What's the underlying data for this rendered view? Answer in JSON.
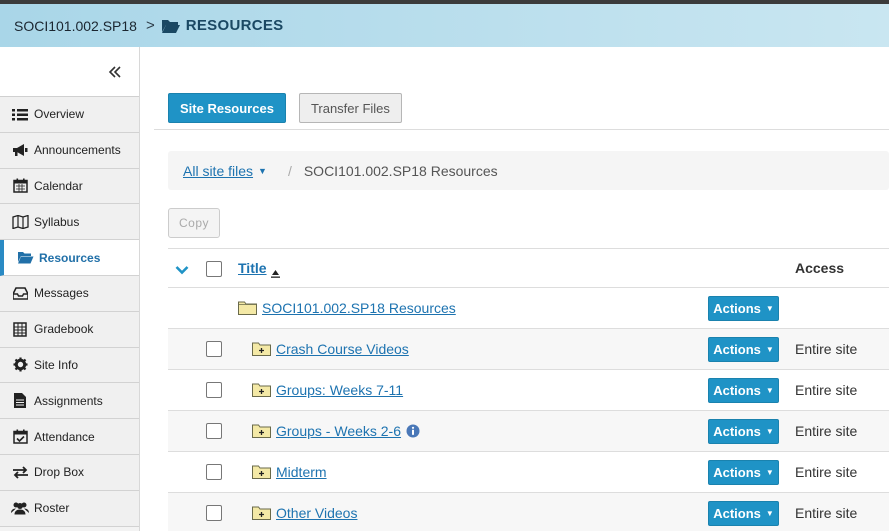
{
  "header": {
    "site_title": "SOCI101.002.SP18",
    "separator": ">",
    "tool_name": "RESOURCES"
  },
  "sidebar": {
    "items": [
      {
        "label": "Overview",
        "icon": "list-icon"
      },
      {
        "label": "Announcements",
        "icon": "megaphone-icon"
      },
      {
        "label": "Calendar",
        "icon": "calendar-icon"
      },
      {
        "label": "Syllabus",
        "icon": "map-icon"
      },
      {
        "label": "Resources",
        "icon": "folder-open-icon",
        "active": true
      },
      {
        "label": "Messages",
        "icon": "inbox-icon"
      },
      {
        "label": "Gradebook",
        "icon": "gradebook-icon"
      },
      {
        "label": "Site Info",
        "icon": "gear-icon"
      },
      {
        "label": "Assignments",
        "icon": "file-icon"
      },
      {
        "label": "Attendance",
        "icon": "calendar-check-icon"
      },
      {
        "label": "Drop Box",
        "icon": "exchange-icon"
      },
      {
        "label": "Roster",
        "icon": "users-icon"
      }
    ]
  },
  "tabs": {
    "site_resources": "Site Resources",
    "transfer_files": "Transfer Files"
  },
  "breadcrumb": {
    "all_site_files": "All site files",
    "separator": "/",
    "current": "SOCI101.002.SP18 Resources"
  },
  "toolbar": {
    "copy_label": "Copy"
  },
  "table": {
    "col_title": "Title",
    "col_access": "Access",
    "root": {
      "title": "SOCI101.002.SP18 Resources",
      "actions": "Actions"
    },
    "rows": [
      {
        "title": "Crash Course Videos",
        "actions": "Actions",
        "access": "Entire site"
      },
      {
        "title": "Groups: Weeks 7-11",
        "actions": "Actions",
        "access": "Entire site"
      },
      {
        "title": "Groups - Weeks 2-6",
        "actions": "Actions",
        "access": "Entire site"
      },
      {
        "title": "Midterm",
        "actions": "Actions",
        "access": "Entire site"
      },
      {
        "title": "Other Videos",
        "actions": "Actions",
        "access": "Entire site"
      }
    ]
  },
  "colors": {
    "primary": "#1f93c6",
    "link": "#1d73b0",
    "folder_fill": "#f4e9a6"
  }
}
